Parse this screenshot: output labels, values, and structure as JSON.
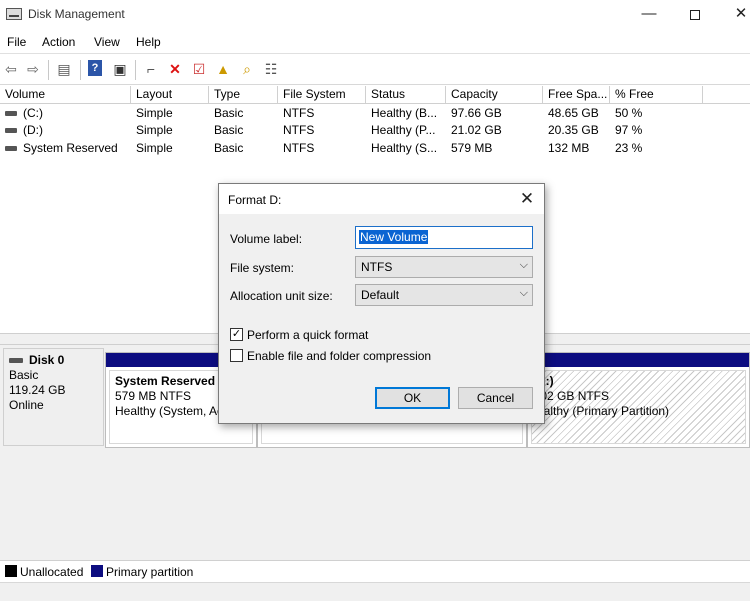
{
  "window": {
    "title": "Disk Management",
    "minimize": "—",
    "close": "✕"
  },
  "menu": [
    "File",
    "Action",
    "View",
    "Help"
  ],
  "toolbar": [
    "back-icon",
    "forward-icon",
    "show-hide-console-tree-icon",
    "help-icon",
    "action-pane-icon",
    "connect-icon",
    "delete-icon",
    "properties-icon",
    "up-folder-icon",
    "search-icon",
    "list-view-icon"
  ],
  "volume_list": {
    "columns": [
      "Volume",
      "Layout",
      "Type",
      "File System",
      "Status",
      "Capacity",
      "Free Spa...",
      "% Free"
    ],
    "rows": [
      [
        "(C:)",
        "Simple",
        "Basic",
        "NTFS",
        "Healthy (B...",
        "97.66 GB",
        "48.65 GB",
        "50 %"
      ],
      [
        "(D:)",
        "Simple",
        "Basic",
        "NTFS",
        "Healthy (P...",
        "21.02 GB",
        "20.35 GB",
        "97 %"
      ],
      [
        "System Reserved",
        "Simple",
        "Basic",
        "NTFS",
        "Healthy (S...",
        "579 MB",
        "132 MB",
        "23 %"
      ]
    ]
  },
  "disk": {
    "name": "Disk 0",
    "type": "Basic",
    "size": "119.24 GB",
    "state": "Online",
    "partitions": [
      {
        "name": "System Reserved",
        "size": "579 MB NTFS",
        "status": "Healthy (System, Ac"
      },
      {
        "name": "",
        "size": "",
        "status": ""
      },
      {
        "name": "D:)",
        "size": ".02 GB NTFS",
        "status": "ealthy (Primary Partition)"
      }
    ]
  },
  "legend": [
    {
      "label": "Unallocated",
      "color": "#000000"
    },
    {
      "label": "Primary partition",
      "color": "#0c0c80"
    }
  ],
  "dialog": {
    "title": "Format D:",
    "volume_label_label": "Volume label:",
    "volume_label_value": "New Volume",
    "file_system_label": "File system:",
    "file_system_value": "NTFS",
    "alloc_label": "Allocation unit size:",
    "alloc_value": "Default",
    "quick_format_label": "Perform a quick format",
    "quick_format_checked": true,
    "compression_label": "Enable file and folder compression",
    "compression_checked": false,
    "ok_label": "OK",
    "cancel_label": "Cancel"
  }
}
